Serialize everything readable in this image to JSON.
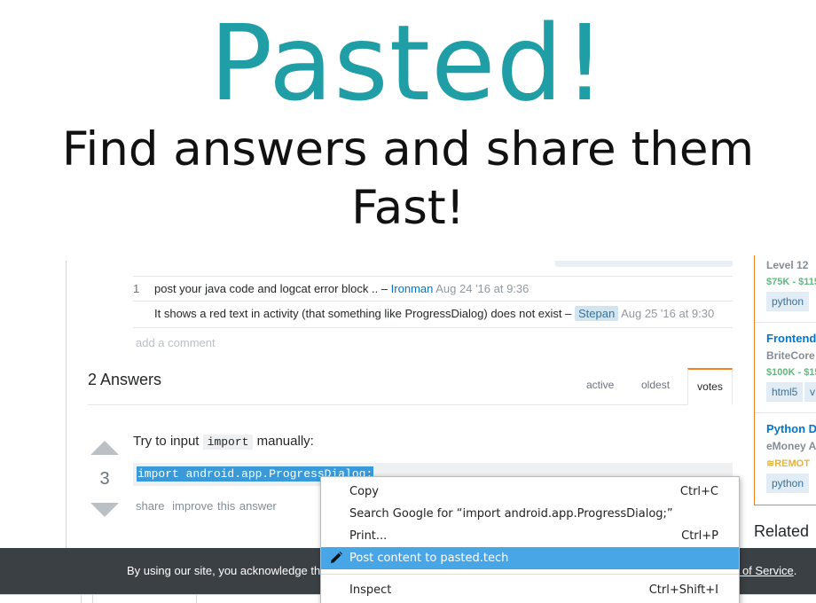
{
  "banner": {
    "title": "Pasted!",
    "subtitle": "Find answers and share them Fast!"
  },
  "comments": [
    {
      "score": "1",
      "text": "post your java code and logcat error block .. – ",
      "user": "Ironman",
      "date": "Aug 24 '16 at 9:36"
    },
    {
      "score": "",
      "text": "It shows a red text in activity (that something like ProgressDialog) does not exist – ",
      "user": "Stepan",
      "date": "Aug 25 '16 at 9:30"
    }
  ],
  "add_comment": "add a comment",
  "answers": {
    "title": "2 Answers",
    "tabs": [
      "active",
      "oldest",
      "votes"
    ],
    "active_tab": "votes"
  },
  "answer": {
    "votes": "3",
    "text_before": "Try to input ",
    "inline_code": "import",
    "text_after": " manually:",
    "code": "import android.app.ProgressDialog;",
    "menu": [
      "share",
      "improve this answer"
    ]
  },
  "jobs": [
    {
      "title": "",
      "company": "Level 12",
      "salary": "$75K - $115",
      "tags": [
        "python"
      ]
    },
    {
      "title": "Frontend",
      "company": "BriteCore",
      "salary": "$100K - $15",
      "tags": [
        "html5",
        "v"
      ]
    },
    {
      "title": "Python D",
      "company": "eMoney A",
      "remote": "REMOT",
      "tags": [
        "python"
      ]
    }
  ],
  "related": "Related",
  "cookie": {
    "text": "By using our site, you acknowledge th",
    "link": "ms of Service",
    "tail": "."
  },
  "context_menu": {
    "items": [
      {
        "label": "Copy",
        "shortcut": "Ctrl+C"
      },
      {
        "label": "Search Google for “import android.app.ProgressDialog;”",
        "shortcut": ""
      },
      {
        "label": "Print...",
        "shortcut": "Ctrl+P"
      },
      {
        "label": "Post content to pasted.tech",
        "shortcut": "",
        "icon": "pencil-icon",
        "highlighted": true
      },
      {
        "label": "Inspect",
        "shortcut": "Ctrl+Shift+I"
      }
    ]
  },
  "colors": {
    "brand_teal": "#1f9ea5",
    "highlight": "#48a6e6",
    "accent_orange": "#f48024",
    "cookie_bar": "#3b4045"
  }
}
